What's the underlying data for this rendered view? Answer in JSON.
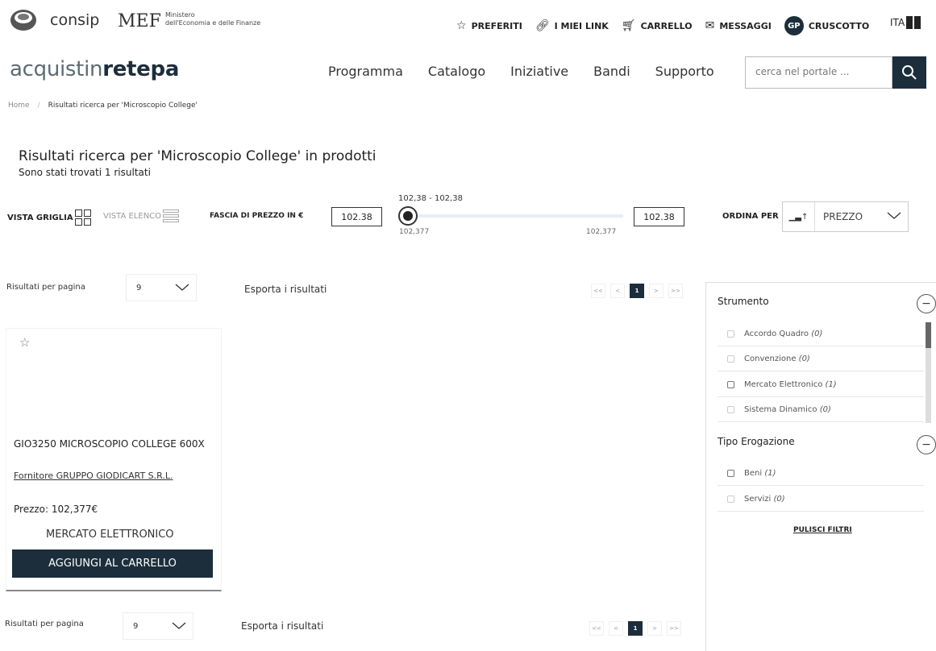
{
  "topbar": {
    "consip": "consip",
    "mef": "MEF",
    "mef_line1": "Ministero",
    "mef_line2": "dell'Economia e delle Finanze",
    "links": [
      {
        "label": "PREFERITI",
        "icon": "star-icon"
      },
      {
        "label": "I MIEI LINK",
        "icon": "link-icon"
      },
      {
        "label": "CARRELLO",
        "icon": "cart-icon"
      },
      {
        "label": "MESSAGGI",
        "icon": "mail-icon"
      }
    ],
    "user_initials": "GP",
    "cruscotto": "CRUSCOTTO",
    "lang": "ITA"
  },
  "nav": {
    "brand_pre": "acquistin",
    "brand_mid": "retepa",
    "items": [
      "Programma",
      "Catalogo",
      "Iniziative",
      "Bandi",
      "Supporto"
    ],
    "search_placeholder": "cerca nel portale ..."
  },
  "breadcrumb": {
    "home": "Home",
    "current": "Risultati ricerca per 'Microscopio College'"
  },
  "results": {
    "title": "Risultati ricerca per 'Microscopio College' in prodotti",
    "count_text": "Sono stati trovati 1 risultati"
  },
  "filters": {
    "vista_griglia": "VISTA GRIGLIA",
    "vista_elenco": "VISTA ELENCO",
    "fascia_label": "FASCIA DI PREZZO IN €",
    "price_min": "102.38",
    "price_max": "102.38",
    "range_label": "102,38 - 102,38",
    "range_min_label": "102,377",
    "range_max_label": "102,377",
    "ordina_label": "ORDINA PER",
    "ordina_value": "PREZZO"
  },
  "paging": {
    "rpp_label": "Risultati per pagina",
    "rpp_value": "9",
    "export_label": "Esporta i risultati",
    "first": "<<",
    "prev": "<",
    "current": "1",
    "next": ">",
    "last": ">>"
  },
  "product": {
    "title": "GIO3250 MICROSCOPIO COLLEGE 600X",
    "supplier": "Fornitore GRUPPO GIODICART S.R.L.",
    "price": "Prezzo: 102,377€",
    "market": "MERCATO ELETTRONICO",
    "add_button": "AGGIUNGI AL CARRELLO"
  },
  "sidebar": {
    "strumento_title": "Strumento",
    "strumento_items": [
      {
        "label": "Accordo Quadro",
        "count": "(0)"
      },
      {
        "label": "Convenzione",
        "count": "(0)"
      },
      {
        "label": "Mercato Elettronico",
        "count": "(1)"
      },
      {
        "label": "Sistema Dinamico",
        "count": "(0)"
      }
    ],
    "tipo_title": "Tipo Erogazione",
    "tipo_items": [
      {
        "label": "Beni",
        "count": "(1)"
      },
      {
        "label": "Servizi",
        "count": "(0)"
      }
    ],
    "pulisci": "PULISCI FILTRI"
  },
  "colors": {
    "primary": "#1c2e3b",
    "accent_gray": "#5b6b73"
  }
}
